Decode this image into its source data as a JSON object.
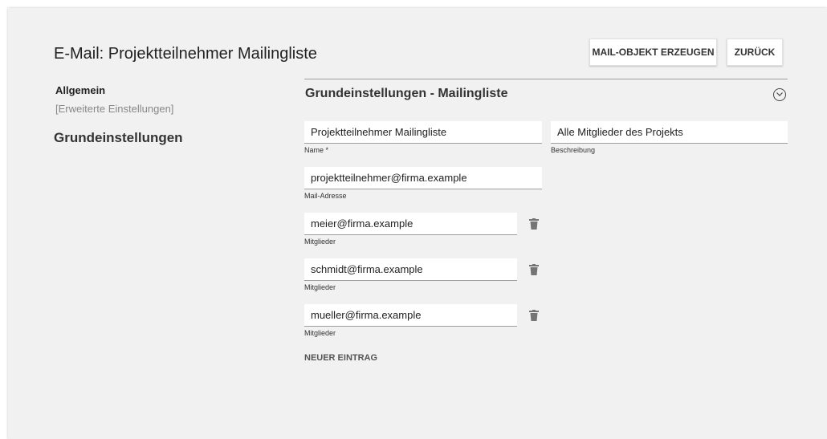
{
  "page": {
    "title": "E-Mail: Projektteilnehmer Mailingliste"
  },
  "header": {
    "create_button": "MAIL-OBJEKT ERZEUGEN",
    "back_button": "ZURÜCK"
  },
  "nav": {
    "general": "Allgemein",
    "advanced": "[Erweiterte Einstellungen]",
    "section": "Grundeinstellungen"
  },
  "section": {
    "title": "Grundeinstellungen - Mailingliste",
    "toggle_icon": "chevron-down-circle-icon"
  },
  "fields": {
    "name": {
      "value": "Projektteilnehmer Mailingliste",
      "label": "Name *"
    },
    "description": {
      "value": "Alle Mitglieder des Projekts",
      "label": "Beschreibung"
    },
    "mail_address": {
      "value": "projektteilnehmer@firma.example",
      "label": "Mail-Adresse"
    }
  },
  "members": [
    {
      "value": "meier@firma.example",
      "label": "Mitglieder"
    },
    {
      "value": "schmidt@firma.example",
      "label": "Mitglieder"
    },
    {
      "value": "mueller@firma.example",
      "label": "Mitglieder"
    }
  ],
  "new_entry": "NEUER EINTRAG",
  "colors": {
    "card_bg": "#f1f1f1",
    "field_bg": "#ffffff",
    "trash_icon": "#757575"
  }
}
